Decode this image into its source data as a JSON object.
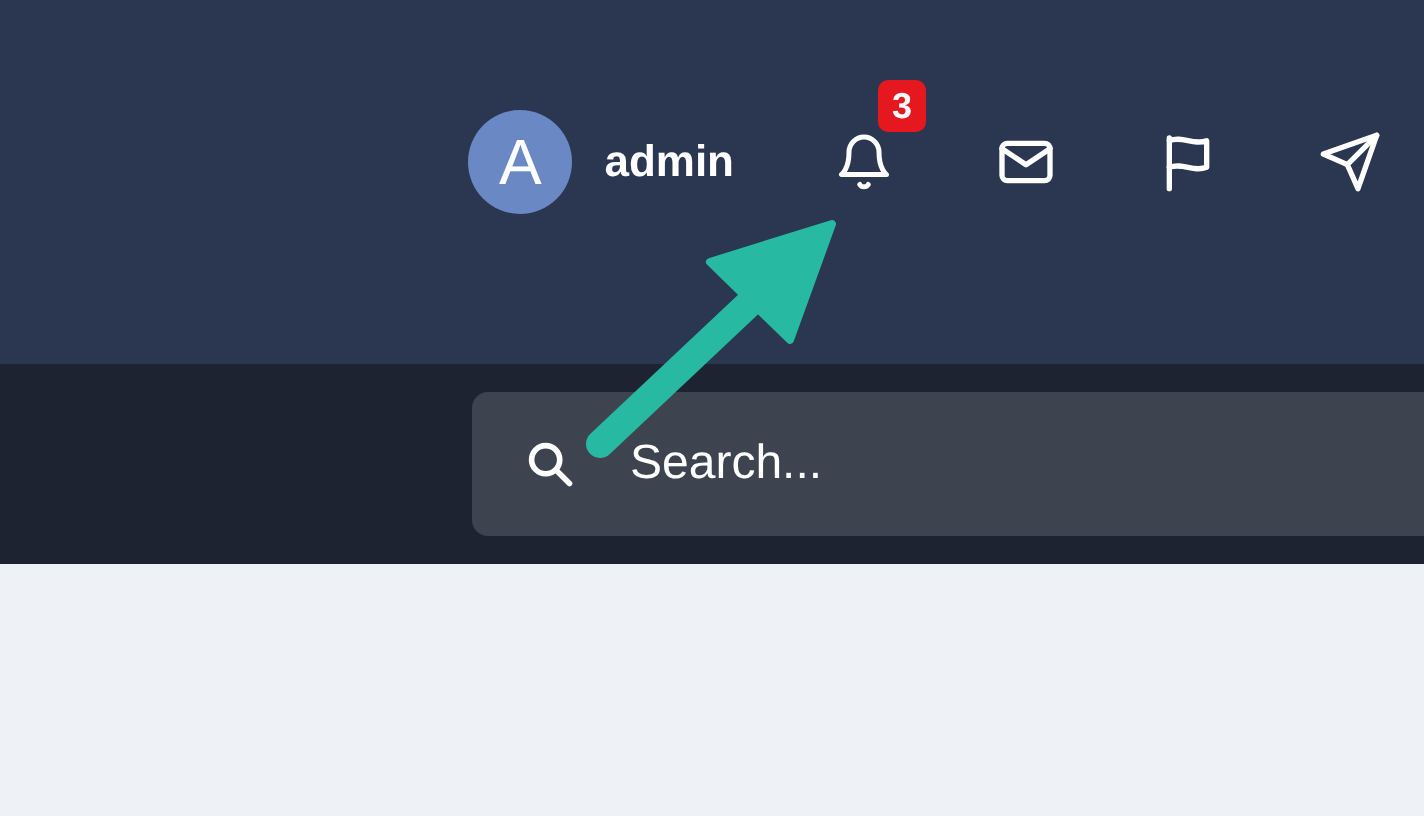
{
  "user": {
    "avatar_initial": "A",
    "name": "admin"
  },
  "toolbar": [
    {
      "kind": "bell",
      "badge": "3"
    },
    {
      "kind": "mail"
    },
    {
      "kind": "flag"
    },
    {
      "kind": "send"
    }
  ],
  "search": {
    "placeholder": "Search..."
  }
}
